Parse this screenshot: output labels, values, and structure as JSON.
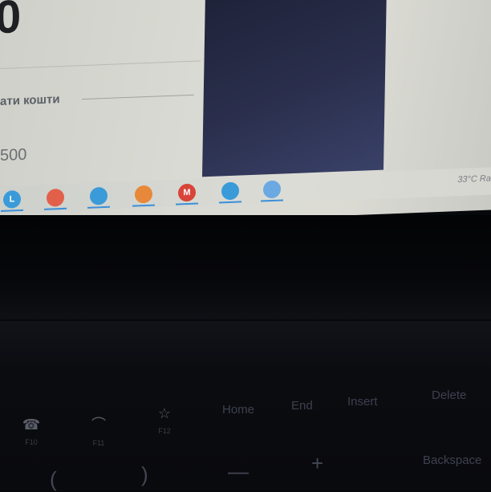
{
  "screen": {
    "big_number": "0",
    "section_label": "ати кошти",
    "amount": "500"
  },
  "taskbar": {
    "icons": [
      {
        "name": "l-app-icon",
        "glyph": "L",
        "color": "#3a9bd8"
      },
      {
        "name": "chrome-icon",
        "glyph": "",
        "color": "#e2604a"
      },
      {
        "name": "chrome-profile-icon-1",
        "glyph": "",
        "color": "#3a9bd8"
      },
      {
        "name": "firefox-icon",
        "glyph": "",
        "color": "#e8883a"
      },
      {
        "name": "mail-icon",
        "glyph": "M",
        "color": "#d8443a"
      },
      {
        "name": "chrome-profile-icon-2",
        "glyph": "",
        "color": "#3a9bd8"
      },
      {
        "name": "file-manager-icon",
        "glyph": "",
        "color": "#6aa9e2"
      }
    ],
    "weather": "33°C  Ra"
  },
  "keyboard": {
    "fn_keys": [
      {
        "glyph": "☎",
        "label": "F10"
      },
      {
        "glyph": "⌒",
        "label": "F11"
      },
      {
        "glyph": "☆",
        "label": "F12"
      }
    ],
    "home": "Home",
    "end": "End",
    "insert": "Insert",
    "delete": "Delete",
    "backspace": "Backspace",
    "paren_open": "(",
    "paren_close": ")",
    "minus": "—",
    "plus": "+"
  }
}
